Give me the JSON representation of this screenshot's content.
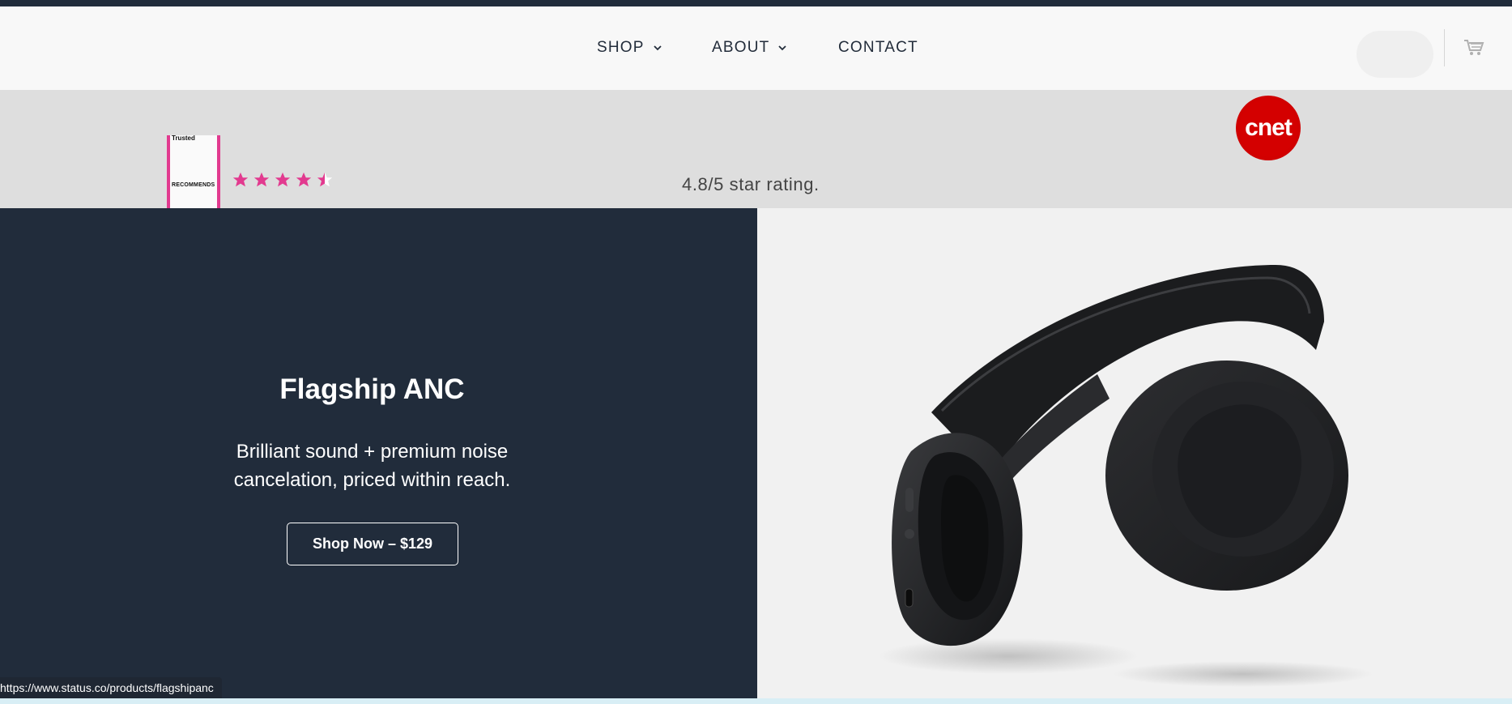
{
  "nav": {
    "items": [
      {
        "label": "SHOP",
        "has_dropdown": true
      },
      {
        "label": "ABOUT",
        "has_dropdown": true
      },
      {
        "label": "CONTACT",
        "has_dropdown": false
      }
    ],
    "cart_icon": "cart-icon"
  },
  "press": {
    "badge_top": "Trusted",
    "badge_label": "RECOMMENDS",
    "stars": 4.5,
    "rating_text": "4.8/5 star rating.",
    "cnet_label": "cnet"
  },
  "hero": {
    "title": "Flagship ANC",
    "description_line1": "Brilliant sound + premium noise",
    "description_line2": "cancelation, priced within reach.",
    "button_label": "Shop Now – $129"
  },
  "status_bar": {
    "url": "https://www.status.co/products/flagshipanc"
  },
  "colors": {
    "navy": "#212c3b",
    "pink": "#e23a8f",
    "cnet_red": "#d40000",
    "header_bg": "#f9f9f9",
    "press_bg": "#dedede"
  }
}
